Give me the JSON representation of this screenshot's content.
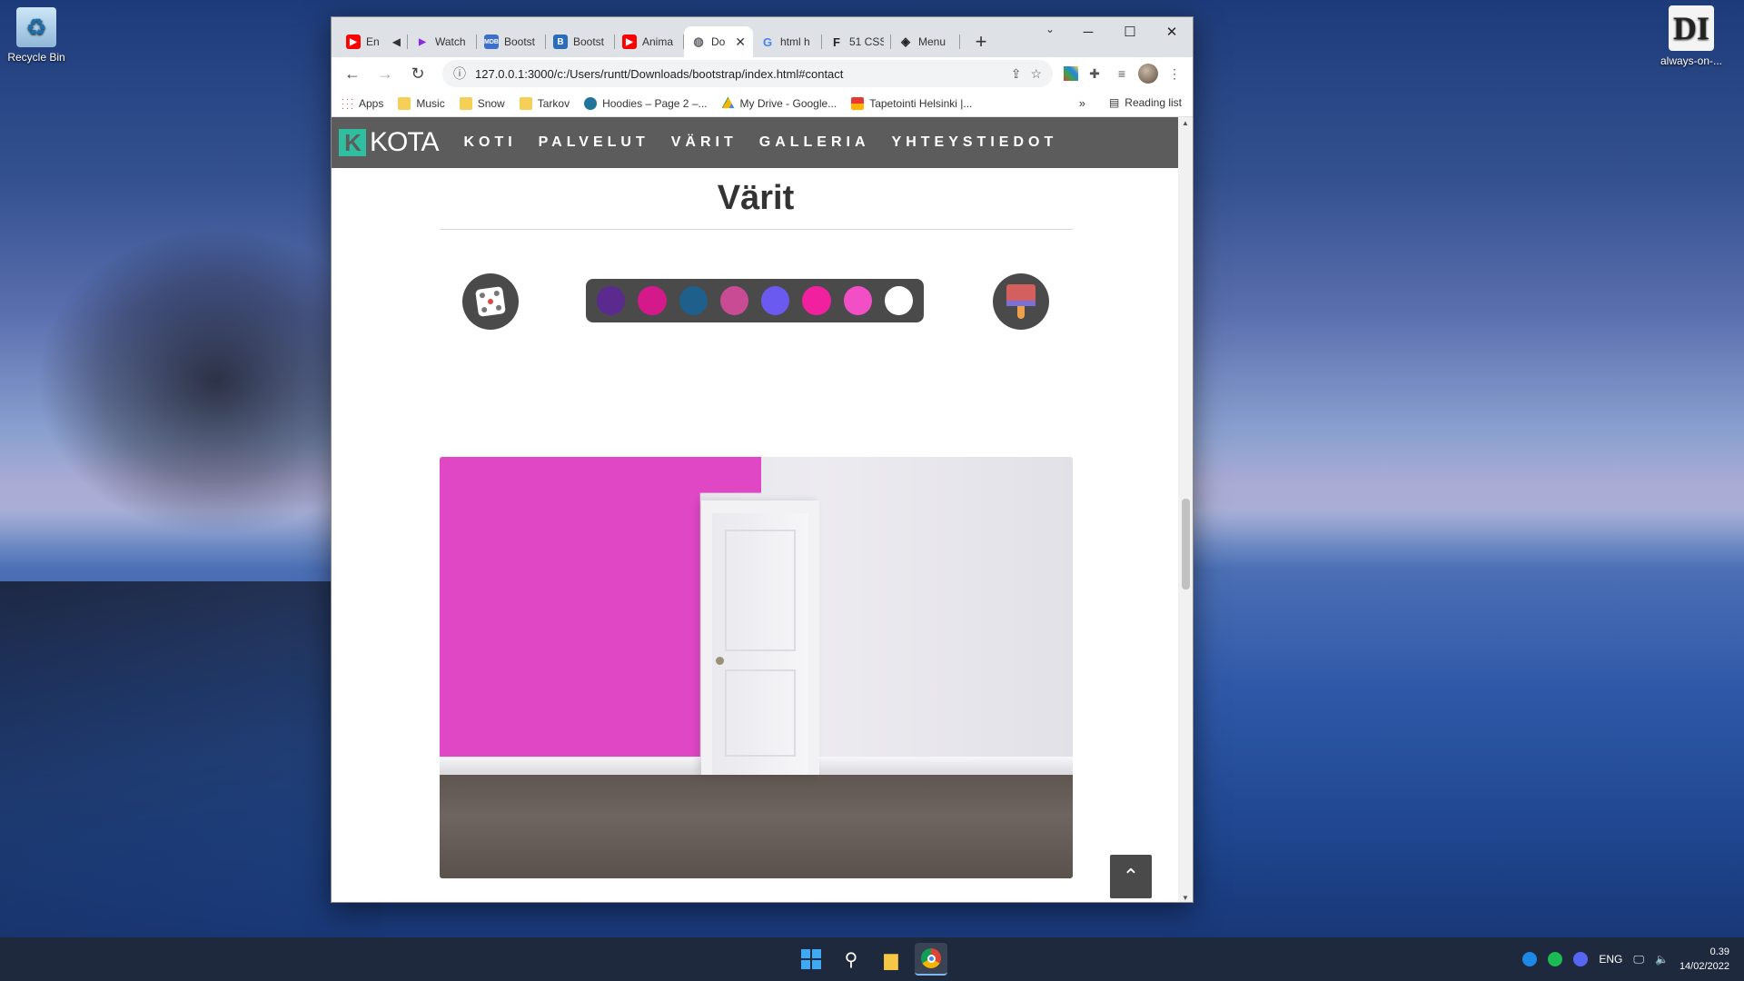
{
  "desktop": {
    "icons": [
      {
        "label": "Recycle Bin"
      },
      {
        "label": "always-on-..."
      }
    ]
  },
  "browser": {
    "tabs": [
      {
        "label": "En",
        "favicon": "youtube-icon",
        "color": "#ff0000"
      },
      {
        "label": "Watch",
        "favicon": "play-icon",
        "color": "#8a2be2"
      },
      {
        "label": "Bootst",
        "favicon": "mdb-icon",
        "color": "#3b71ca"
      },
      {
        "label": "Bootst",
        "favicon": "bootstrap-icon",
        "color": "#2a6dbb"
      },
      {
        "label": "Anima",
        "favicon": "youtube-icon",
        "color": "#ff0000"
      },
      {
        "label": "Do",
        "favicon": "globe-icon",
        "color": "#5f6368",
        "active": true
      },
      {
        "label": "html h",
        "favicon": "google-icon",
        "color": "#4285f4"
      },
      {
        "label": "51 CSS",
        "favicon": "freefrontend-icon",
        "color": "#222222"
      },
      {
        "label": "Menu",
        "favicon": "codepen-icon",
        "color": "#222222"
      }
    ],
    "new_tab": "+",
    "address": "127.0.0.1:3000/c:/Users/runtt/Downloads/bootstrap/index.html#contact",
    "bookmarks": [
      {
        "label": "Apps",
        "icon": "apps-grid-icon"
      },
      {
        "label": "Music",
        "icon": "folder-icon"
      },
      {
        "label": "Snow",
        "icon": "folder-icon"
      },
      {
        "label": "Tarkov",
        "icon": "folder-icon"
      },
      {
        "label": "Hoodies – Page 2 –...",
        "icon": "wordpress-icon"
      },
      {
        "label": "My Drive - Google...",
        "icon": "google-drive-icon"
      },
      {
        "label": "Tapetointi Helsinki |...",
        "icon": "site-icon"
      }
    ],
    "bookmarks_more": "»",
    "reading_list": "Reading list"
  },
  "site": {
    "logo_letter": "K",
    "logo_text": "KOTA",
    "nav": [
      "KOTI",
      "PALVELUT",
      "VÄRIT",
      "GALLERIA",
      "YHTEYSTIEDOT"
    ],
    "section_title": "Värit",
    "swatches": [
      "#5b2a8e",
      "#d4198a",
      "#1f5f8b",
      "#c94b94",
      "#6a5af0",
      "#f0209e",
      "#f24fc7",
      "#ffffff"
    ],
    "selected_wall_color": "#df47c5",
    "to_top": "⌃"
  },
  "taskbar": {
    "language": "ENG",
    "time": "0.39",
    "date": "14/02/2022"
  }
}
